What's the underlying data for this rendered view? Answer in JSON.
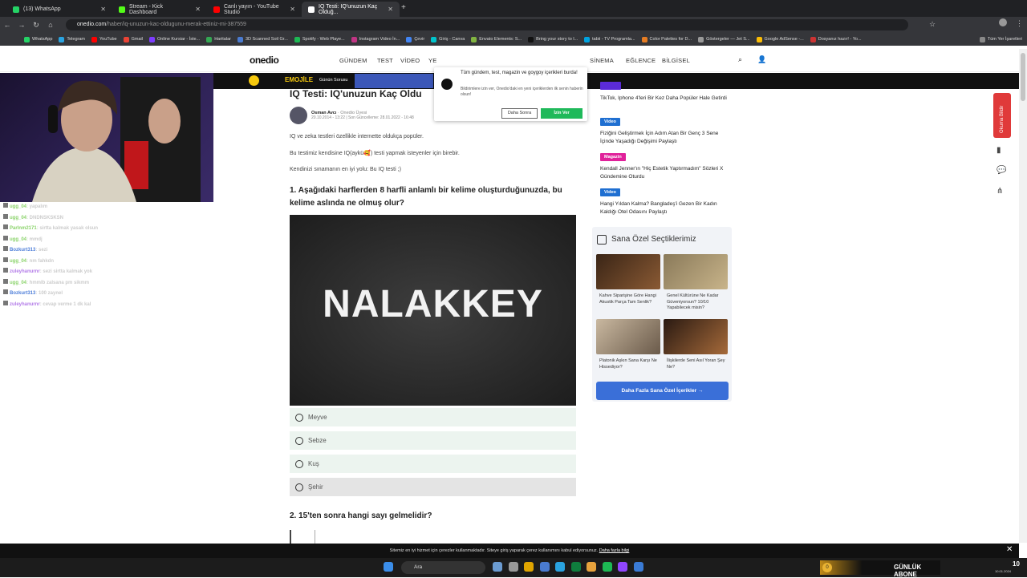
{
  "tabs": [
    {
      "label": "(13) WhatsApp",
      "color": "#25d366"
    },
    {
      "label": "Stream - Kick Dashboard",
      "color": "#53fc18"
    },
    {
      "label": "Canlı yayın - YouTube Studio",
      "color": "#ff0000"
    },
    {
      "label": "IQ Testi: IQ'unuzun Kaç Olduğ...",
      "color": "#ffffff"
    }
  ],
  "url": {
    "host": "onedio.com",
    "path": "/haber/iq-unuzun-kac-oldugunu-merak-ettiniz-mi-387559"
  },
  "bookmarks": [
    "WhatsApp",
    "Telegram",
    "YouTube",
    "Gmail",
    "Online Kursiar - İste...",
    "Haritalar",
    "3D Scanned Soil Gr...",
    "Spotify - Web Playe...",
    "Instagram Video İn...",
    "Çevir",
    "Giriş - Canva",
    "Envato Elements: S...",
    "Bring your story to l...",
    "tabii - TV Programla...",
    "Color Palettes for D...",
    "Göstergeler — Jet S...",
    "Google AdSense -...",
    "Dosyanız hazır! - Yo...",
    "Tüm Yer İşaretleri"
  ],
  "site": {
    "logo": "onedio",
    "nav": [
      "GÜNDEM",
      "TEST",
      "VİDEO",
      "YE",
      "SİNEMA",
      "EĞLENCE",
      "BİLGİSEL"
    ],
    "stripe_label": "Günün Sorusu",
    "stripe_brand": "EMOJİLE"
  },
  "chat": [
    {
      "user": "ugg_04",
      "msg": ": yapalım"
    },
    {
      "user": "ugg_04",
      "msg": ": DNDNSKSKSN"
    },
    {
      "user": "Parlnm2171",
      "msg": ": sirtta kalmak yasak olsun"
    },
    {
      "user": "ugg_04",
      "msg": ": mmdj"
    },
    {
      "user": "Bozkurt313",
      "msg": ": sezi"
    },
    {
      "user": "ugg_04",
      "msg": ": nm fahkdn"
    },
    {
      "user": "zuleyhanurnr",
      "msg": ": sezi sirtta kalmak yok"
    },
    {
      "user": "ugg_04",
      "msg": ": hmmlb zalsana pm sikmm"
    },
    {
      "user": "Bozkurt313",
      "msg": ": 100 zaynel"
    },
    {
      "user": "zuleyhanurnr",
      "msg": ": cevap verme 1 dk kal"
    }
  ],
  "article": {
    "title": "IQ Testi: IQ'unuzun Kaç Oldu",
    "author": "Osman Avcı",
    "author_role": "· Onedio Üyesi",
    "dates": "20.10.2014 - 13:22 | Son Güncelleme: 28.01.2022 - 16:48",
    "intro": [
      "IQ ve zeka testleri özellikle internette oldukça popüler.",
      "Bu testimiz kendisine IQ(aykü🥰) testi yapmak isteyenler için birebir.",
      "Kendinizi sınamanın en iyi yolu: Bu IQ testi ;)"
    ],
    "q1": "1. Aşağıdaki harflerden 8 harfli anlamlı bir kelime oluşturduğunuzda, bu kelime aslında ne olmuş olur?",
    "q1_image_text": "NALAKKEY",
    "options": [
      "Meyve",
      "Sebze",
      "Kuş",
      "Şehir"
    ],
    "q2": "2. 15'ten sonra hangi sayı gelmelidir?"
  },
  "popup": {
    "title": "Tüm gündem, test, magazin ve goygoy içerikleri burda!",
    "body": "Bildirimlere izin ver, Onedio'daki en yeni içeriklerden ilk senin haberin olsun!",
    "later": "Daha Sonra",
    "allow": "İzin Ver"
  },
  "sidebar": {
    "items": [
      {
        "badge": "",
        "text": "TikTok, Iphone 4'leri Bir Kez Daha Popüler Hale Getirdi",
        "color": "#5b2bd8"
      },
      {
        "badge": "Video",
        "text": "Fiziğini Geliştirmek İçin Adım Atan Bir Genç 3 Sene İçinde Yaşadığı Değişimi Paylaştı",
        "color": "#1f6fd1"
      },
      {
        "badge": "Magazin",
        "text": "Kendall Jenner'ın \"Hiç Estetik Yaptırmadım\" Sözleri X Gündemine Oturdu",
        "color": "#e0219a"
      },
      {
        "badge": "Video",
        "text": "Hangi Yıldan Kalma? Bangladeş'i Gezen Bir Kadın Kaldığı Otel Odasını Paylaştı",
        "color": "#1f6fd1"
      }
    ],
    "picks_title": "Sana Özel Seçtiklerimiz",
    "picks": [
      {
        "text": "Kahve Siparişine Göre Hangi Akustik Parça Tam Senlik?"
      },
      {
        "text": "Genel Kültürüne Ne Kadar Güveniyorsun? 10/10 Yapabilecek misin?"
      },
      {
        "text": "Platonik Aşkın Sana Karşı Ne Hissediyor?"
      },
      {
        "text": "İlişkilerde Seni Asıl Yoran Şey Ne?"
      }
    ],
    "more": "Daha Fazla Sana Özel İçerikler →",
    "reading_label": "Okuma Bildir"
  },
  "cookie": {
    "text": "Sitemiz en iyi hizmet için çerezler kullanmaktadır. Siteye giriş yaparak çerez kullanımını kabul ediyorsunuz.",
    "link": "Daha fazla bilgi"
  },
  "taskbar": {
    "search": "Ara",
    "counter": "0",
    "ticker": "GÜNLÜK ABONE",
    "badge": "10",
    "time": "10.01.2024"
  }
}
